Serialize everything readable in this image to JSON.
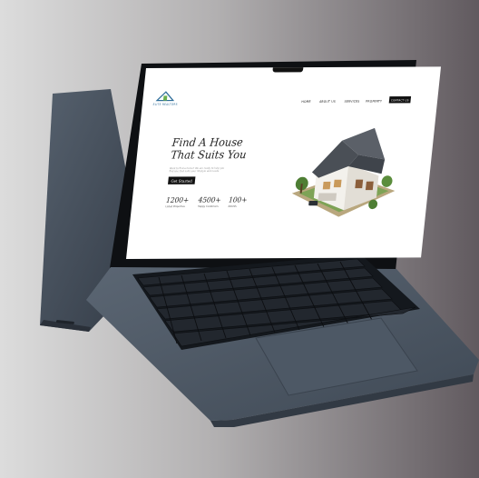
{
  "website": {
    "logo_text": "ELITE REALTORS",
    "nav": {
      "items": [
        "HOME",
        "ABOUT US",
        "SERVICES",
        "PROPERTY"
      ],
      "cta": "CONTACT US"
    },
    "hero": {
      "title_line1": "Find A House",
      "title_line2": "That Suits You",
      "subtitle": "Want to find a home? We are ready to help you find one that suits your lifestyle and needs",
      "button": "Get Started"
    },
    "stats": [
      {
        "value": "1200+",
        "label": "Listed Properties"
      },
      {
        "value": "4500+",
        "label": "Happy Customers"
      },
      {
        "value": "100+",
        "label": "Awards"
      }
    ]
  },
  "colors": {
    "background_left": "#d6d6d6",
    "background_right": "#645d61",
    "laptop_body": "#4a5563",
    "keyboard": "#161a1f"
  }
}
